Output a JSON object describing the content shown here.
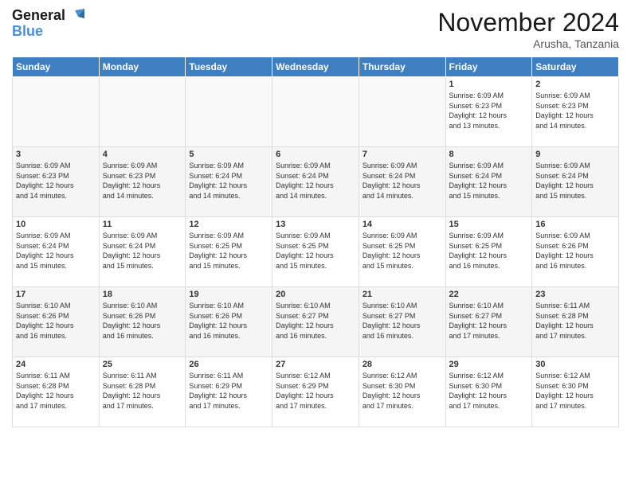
{
  "header": {
    "logo_line1": "General",
    "logo_line2": "Blue",
    "month": "November 2024",
    "location": "Arusha, Tanzania"
  },
  "weekdays": [
    "Sunday",
    "Monday",
    "Tuesday",
    "Wednesday",
    "Thursday",
    "Friday",
    "Saturday"
  ],
  "weeks": [
    [
      {
        "day": "",
        "info": ""
      },
      {
        "day": "",
        "info": ""
      },
      {
        "day": "",
        "info": ""
      },
      {
        "day": "",
        "info": ""
      },
      {
        "day": "",
        "info": ""
      },
      {
        "day": "1",
        "info": "Sunrise: 6:09 AM\nSunset: 6:23 PM\nDaylight: 12 hours\nand 13 minutes."
      },
      {
        "day": "2",
        "info": "Sunrise: 6:09 AM\nSunset: 6:23 PM\nDaylight: 12 hours\nand 14 minutes."
      }
    ],
    [
      {
        "day": "3",
        "info": "Sunrise: 6:09 AM\nSunset: 6:23 PM\nDaylight: 12 hours\nand 14 minutes."
      },
      {
        "day": "4",
        "info": "Sunrise: 6:09 AM\nSunset: 6:23 PM\nDaylight: 12 hours\nand 14 minutes."
      },
      {
        "day": "5",
        "info": "Sunrise: 6:09 AM\nSunset: 6:24 PM\nDaylight: 12 hours\nand 14 minutes."
      },
      {
        "day": "6",
        "info": "Sunrise: 6:09 AM\nSunset: 6:24 PM\nDaylight: 12 hours\nand 14 minutes."
      },
      {
        "day": "7",
        "info": "Sunrise: 6:09 AM\nSunset: 6:24 PM\nDaylight: 12 hours\nand 14 minutes."
      },
      {
        "day": "8",
        "info": "Sunrise: 6:09 AM\nSunset: 6:24 PM\nDaylight: 12 hours\nand 15 minutes."
      },
      {
        "day": "9",
        "info": "Sunrise: 6:09 AM\nSunset: 6:24 PM\nDaylight: 12 hours\nand 15 minutes."
      }
    ],
    [
      {
        "day": "10",
        "info": "Sunrise: 6:09 AM\nSunset: 6:24 PM\nDaylight: 12 hours\nand 15 minutes."
      },
      {
        "day": "11",
        "info": "Sunrise: 6:09 AM\nSunset: 6:24 PM\nDaylight: 12 hours\nand 15 minutes."
      },
      {
        "day": "12",
        "info": "Sunrise: 6:09 AM\nSunset: 6:25 PM\nDaylight: 12 hours\nand 15 minutes."
      },
      {
        "day": "13",
        "info": "Sunrise: 6:09 AM\nSunset: 6:25 PM\nDaylight: 12 hours\nand 15 minutes."
      },
      {
        "day": "14",
        "info": "Sunrise: 6:09 AM\nSunset: 6:25 PM\nDaylight: 12 hours\nand 15 minutes."
      },
      {
        "day": "15",
        "info": "Sunrise: 6:09 AM\nSunset: 6:25 PM\nDaylight: 12 hours\nand 16 minutes."
      },
      {
        "day": "16",
        "info": "Sunrise: 6:09 AM\nSunset: 6:26 PM\nDaylight: 12 hours\nand 16 minutes."
      }
    ],
    [
      {
        "day": "17",
        "info": "Sunrise: 6:10 AM\nSunset: 6:26 PM\nDaylight: 12 hours\nand 16 minutes."
      },
      {
        "day": "18",
        "info": "Sunrise: 6:10 AM\nSunset: 6:26 PM\nDaylight: 12 hours\nand 16 minutes."
      },
      {
        "day": "19",
        "info": "Sunrise: 6:10 AM\nSunset: 6:26 PM\nDaylight: 12 hours\nand 16 minutes."
      },
      {
        "day": "20",
        "info": "Sunrise: 6:10 AM\nSunset: 6:27 PM\nDaylight: 12 hours\nand 16 minutes."
      },
      {
        "day": "21",
        "info": "Sunrise: 6:10 AM\nSunset: 6:27 PM\nDaylight: 12 hours\nand 16 minutes."
      },
      {
        "day": "22",
        "info": "Sunrise: 6:10 AM\nSunset: 6:27 PM\nDaylight: 12 hours\nand 17 minutes."
      },
      {
        "day": "23",
        "info": "Sunrise: 6:11 AM\nSunset: 6:28 PM\nDaylight: 12 hours\nand 17 minutes."
      }
    ],
    [
      {
        "day": "24",
        "info": "Sunrise: 6:11 AM\nSunset: 6:28 PM\nDaylight: 12 hours\nand 17 minutes."
      },
      {
        "day": "25",
        "info": "Sunrise: 6:11 AM\nSunset: 6:28 PM\nDaylight: 12 hours\nand 17 minutes."
      },
      {
        "day": "26",
        "info": "Sunrise: 6:11 AM\nSunset: 6:29 PM\nDaylight: 12 hours\nand 17 minutes."
      },
      {
        "day": "27",
        "info": "Sunrise: 6:12 AM\nSunset: 6:29 PM\nDaylight: 12 hours\nand 17 minutes."
      },
      {
        "day": "28",
        "info": "Sunrise: 6:12 AM\nSunset: 6:30 PM\nDaylight: 12 hours\nand 17 minutes."
      },
      {
        "day": "29",
        "info": "Sunrise: 6:12 AM\nSunset: 6:30 PM\nDaylight: 12 hours\nand 17 minutes."
      },
      {
        "day": "30",
        "info": "Sunrise: 6:12 AM\nSunset: 6:30 PM\nDaylight: 12 hours\nand 17 minutes."
      }
    ]
  ]
}
